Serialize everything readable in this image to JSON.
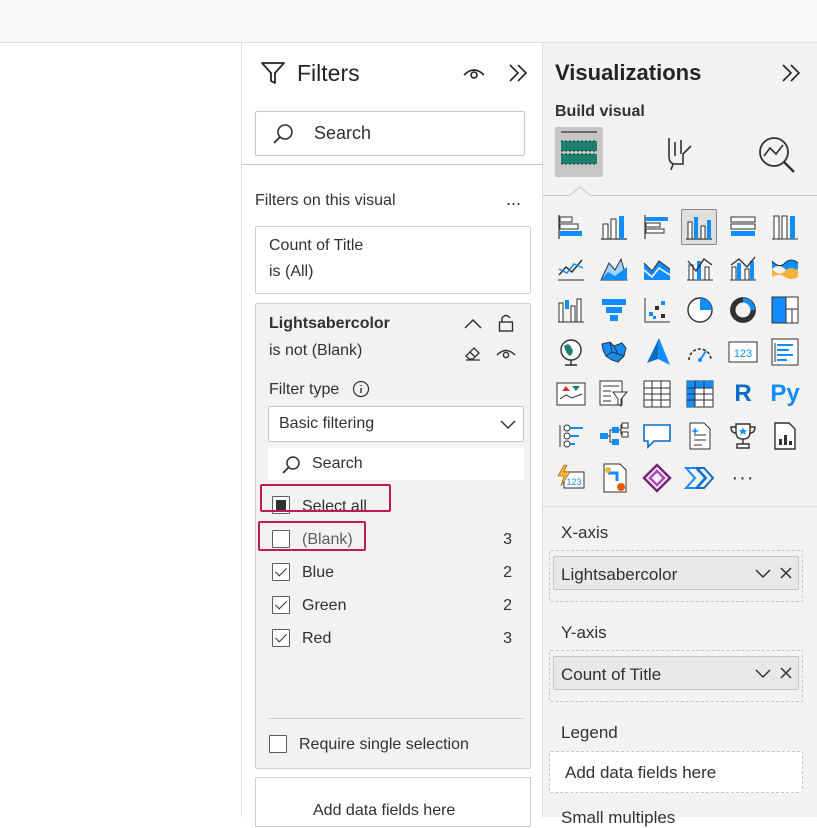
{
  "filters_pane": {
    "title": "Filters",
    "search_placeholder": "Search",
    "section_label": "Filters on this visual",
    "more_label": "...",
    "collapsed_card": {
      "field": "Count of Title",
      "condition": "is (All)"
    },
    "expanded_card": {
      "field": "Lightsabercolor",
      "condition": "is not (Blank)",
      "filter_type_label": "Filter type",
      "filter_type_value": "Basic filtering",
      "search_placeholder": "Search",
      "items": [
        {
          "label": "Select all",
          "state": "partial",
          "count": ""
        },
        {
          "label": "(Blank)",
          "state": "unchecked",
          "count": "3"
        },
        {
          "label": "Blue",
          "state": "checked",
          "count": "2"
        },
        {
          "label": "Green",
          "state": "checked",
          "count": "2"
        },
        {
          "label": "Red",
          "state": "checked",
          "count": "3"
        }
      ],
      "require_single_label": "Require single selection"
    },
    "add_fields_label": "Add data fields here"
  },
  "viz_pane": {
    "title": "Visualizations",
    "subtitle": "Build visual",
    "more_label": "···",
    "r_label": "R",
    "py_label": "Py",
    "num_label": "123",
    "wells": {
      "x_axis": {
        "label": "X-axis",
        "field": "Lightsabercolor"
      },
      "y_axis": {
        "label": "Y-axis",
        "field": "Count of Title"
      },
      "legend": {
        "label": "Legend",
        "placeholder": "Add data fields here"
      },
      "small_multiples": {
        "label": "Small multiples"
      }
    }
  },
  "colors": {
    "accent": "#118dff",
    "highlight": "#c2185b",
    "teal": "#1a7f6e"
  }
}
